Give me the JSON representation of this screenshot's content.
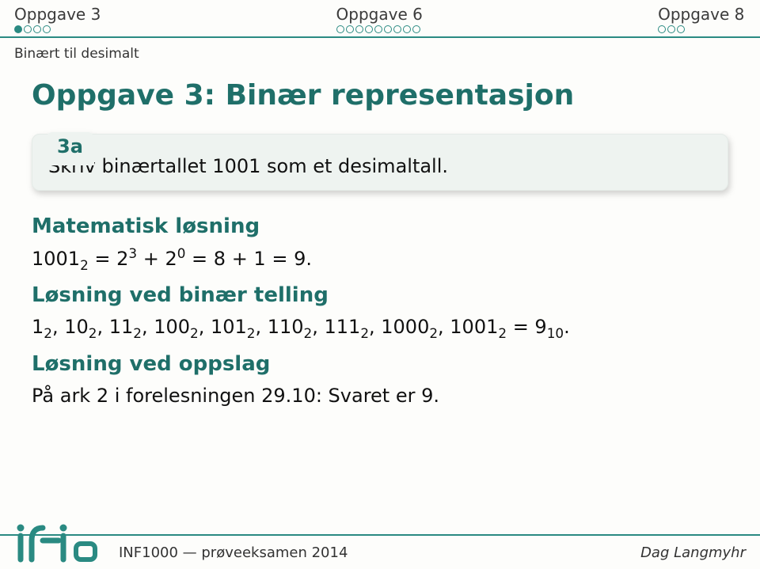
{
  "nav": {
    "left": "Oppgave 3",
    "mid": "Oppgave 6",
    "right": "Oppgave 8",
    "dots_left_total": 4,
    "dots_left_filled": 1,
    "dots_mid_total": 9,
    "dots_mid_filled": 0,
    "dots_right_total": 3,
    "dots_right_filled": 0
  },
  "subtitle": "Binært til desimalt",
  "title": "Oppgave 3: Binær representasjon",
  "box": {
    "label": "3a",
    "body": "Skriv binærtallet 1001 som et desimaltall."
  },
  "sections": {
    "mat_heading": "Matematisk løsning",
    "mat_line_parts": {
      "p1": "1001",
      "sub1": "2",
      "p2": " = 2",
      "sup1": "3",
      "p3": " + 2",
      "sup2": "0",
      "p4": " = 8 + 1 = 9."
    },
    "tell_heading": "Løsning ved binær telling",
    "tell_line_parts": {
      "seq": [
        {
          "v": "1",
          "s": "2"
        },
        {
          "v": "10",
          "s": "2"
        },
        {
          "v": "11",
          "s": "2"
        },
        {
          "v": "100",
          "s": "2"
        },
        {
          "v": "101",
          "s": "2"
        },
        {
          "v": "110",
          "s": "2"
        },
        {
          "v": "111",
          "s": "2"
        },
        {
          "v": "1000",
          "s": "2"
        }
      ],
      "last_v": "1001",
      "last_s": "2",
      "eq": " = 9",
      "eq_s": "10",
      "dot": "."
    },
    "opp_heading": "Løsning ved oppslag",
    "opp_line": "På ark 2 i forelesningen 29.10: Svaret er 9."
  },
  "footer": {
    "left": "INF1000 — prøveeksamen 2014",
    "right": "Dag Langmyhr"
  }
}
